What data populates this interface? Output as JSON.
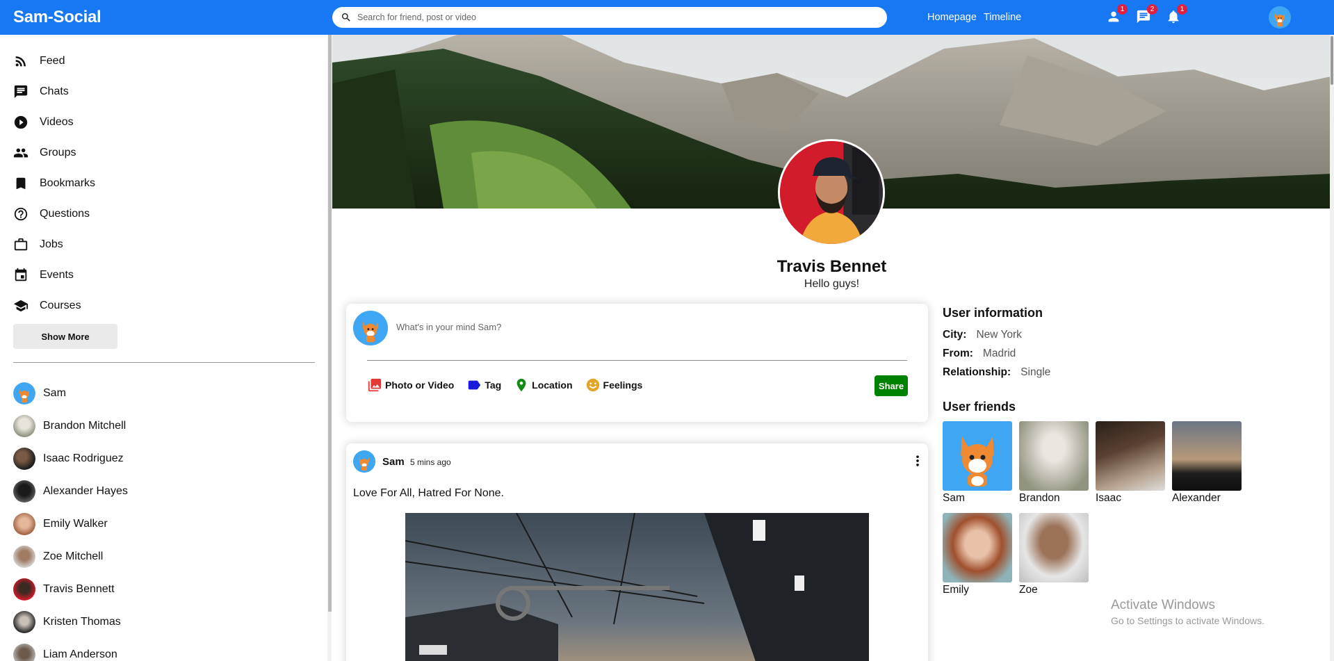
{
  "app": {
    "title": "Sam-Social"
  },
  "search": {
    "placeholder": "Search for friend, post or video"
  },
  "nav": {
    "homepage": "Homepage",
    "timeline": "Timeline"
  },
  "notifications": {
    "friends": "1",
    "messages": "2",
    "alerts": "1"
  },
  "sidebar": {
    "items": [
      {
        "label": "Feed",
        "icon": "rss-icon"
      },
      {
        "label": "Chats",
        "icon": "chat-icon"
      },
      {
        "label": "Videos",
        "icon": "play-circle-icon"
      },
      {
        "label": "Groups",
        "icon": "group-icon"
      },
      {
        "label": "Bookmarks",
        "icon": "bookmark-icon"
      },
      {
        "label": "Questions",
        "icon": "help-icon"
      },
      {
        "label": "Jobs",
        "icon": "briefcase-icon"
      },
      {
        "label": "Events",
        "icon": "calendar-icon"
      },
      {
        "label": "Courses",
        "icon": "school-icon"
      }
    ],
    "show_more": "Show More",
    "friends": [
      "Sam",
      "Brandon Mitchell",
      "Isaac Rodriguez",
      "Alexander Hayes",
      "Emily Walker",
      "Zoe Mitchell",
      "Travis Bennett",
      "Kristen Thomas",
      "Liam Anderson"
    ]
  },
  "profile": {
    "name": "Travis Bennet",
    "desc": "Hello guys!"
  },
  "share": {
    "placeholder": "What's in your mind Sam?",
    "options": {
      "photo": "Photo or Video",
      "tag": "Tag",
      "location": "Location",
      "feelings": "Feelings"
    },
    "button": "Share"
  },
  "post": {
    "user": "Sam",
    "date": "5 mins ago",
    "text": "Love For All, Hatred For None."
  },
  "user_info": {
    "title": "User information",
    "city_label": "City:",
    "city": "New York",
    "from_label": "From:",
    "from": "Madrid",
    "relationship_label": "Relationship:",
    "relationship": "Single"
  },
  "user_friends": {
    "title": "User friends",
    "items": [
      "Sam",
      "Brandon",
      "Isaac",
      "Alexander",
      "Emily",
      "Zoe"
    ]
  },
  "watermark": {
    "line1": "Activate Windows",
    "line2": "Go to Settings to activate Windows."
  },
  "colors": {
    "primary": "#1877f2",
    "share_button": "#008000",
    "badge": "#e41e3f"
  }
}
